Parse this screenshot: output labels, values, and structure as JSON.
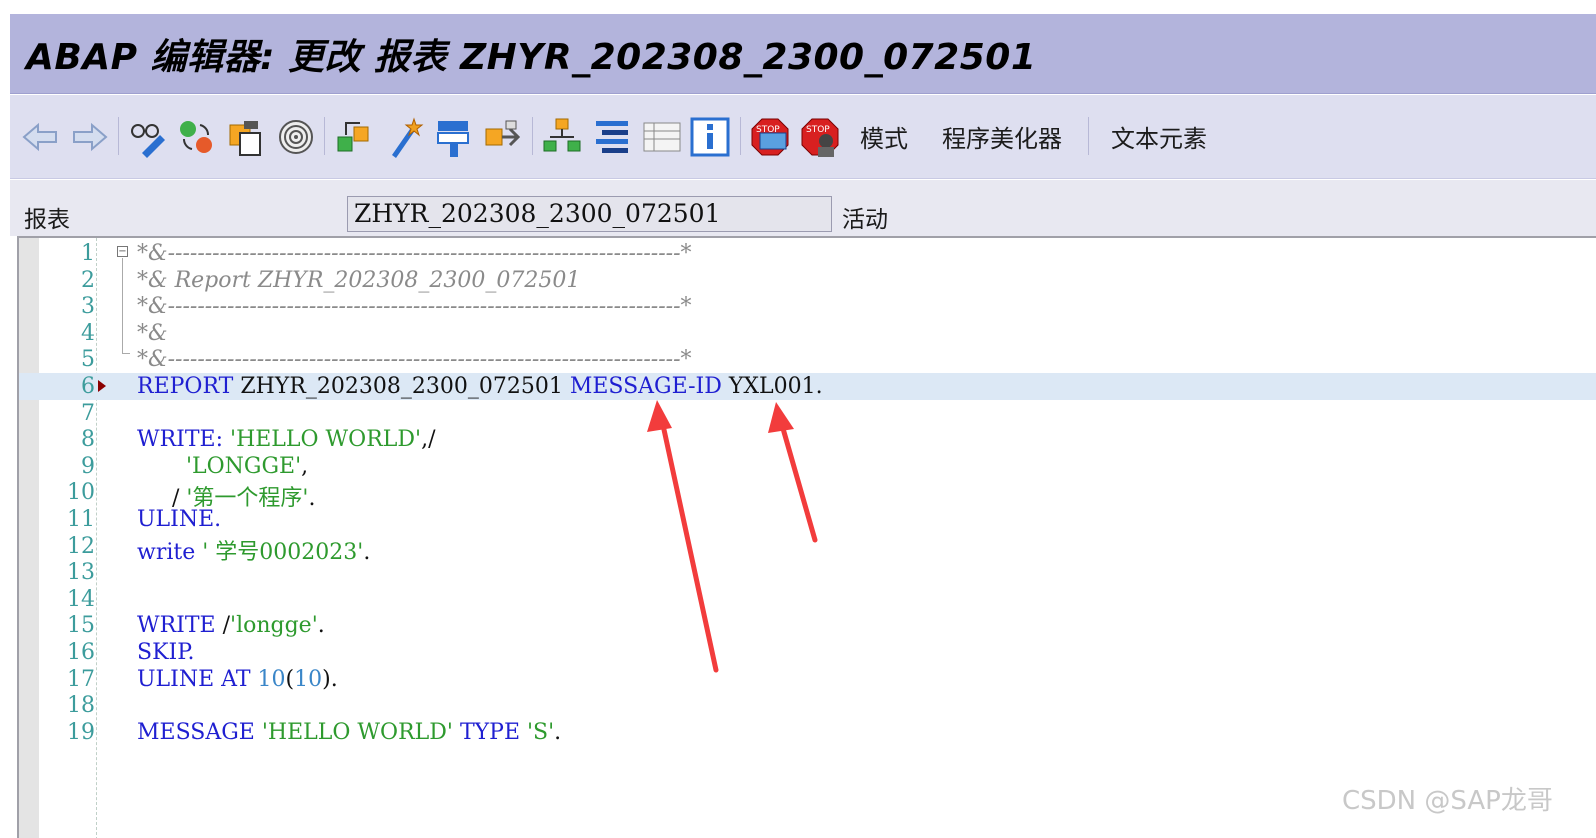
{
  "window": {
    "title": "ABAP 编辑器: 更改 报表 ZHYR_202308_2300_072501"
  },
  "toolbar": {
    "buttons": [
      {
        "name": "back-arrow-icon"
      },
      {
        "name": "forward-arrow-icon"
      },
      {
        "name": "glasses-pencil-icon"
      },
      {
        "name": "object-switch-icon"
      },
      {
        "name": "copy-object-icon"
      },
      {
        "name": "spiral-icon"
      },
      {
        "name": "check-icon"
      },
      {
        "name": "activate-wand-icon"
      },
      {
        "name": "test-run-icon"
      },
      {
        "name": "where-used-icon"
      },
      {
        "name": "hierarchy-icon"
      },
      {
        "name": "pretty-format-icon"
      },
      {
        "name": "list-view-icon"
      },
      {
        "name": "info-icon"
      },
      {
        "name": "stop-breakpoint-icon"
      },
      {
        "name": "stop-user-breakpoint-icon"
      }
    ],
    "text_buttons": [
      "模式",
      "程序美化器",
      "文本元素"
    ]
  },
  "selection": {
    "label": "报表",
    "program_name": "ZHYR_202308_2300_072501",
    "status": "活动"
  },
  "editor": {
    "lines": [
      {
        "n": "1",
        "tokens": [
          {
            "t": "*&---------------------------------------------------------------------*",
            "c": "c-cmt"
          }
        ]
      },
      {
        "n": "2",
        "tokens": [
          {
            "t": "*& Report ZHYR_202308_2300_072501",
            "c": "c-cmt"
          }
        ]
      },
      {
        "n": "3",
        "tokens": [
          {
            "t": "*&---------------------------------------------------------------------*",
            "c": "c-cmt"
          }
        ]
      },
      {
        "n": "4",
        "tokens": [
          {
            "t": "*&",
            "c": "c-cmt"
          }
        ]
      },
      {
        "n": "5",
        "tokens": [
          {
            "t": "*&---------------------------------------------------------------------*",
            "c": "c-cmt"
          }
        ]
      },
      {
        "n": "6",
        "highlight": true,
        "marker": true,
        "tokens": [
          {
            "t": "REPORT",
            "c": "c-kw"
          },
          {
            "t": " ZHYR_202308_2300_072501 ",
            "c": "c-id"
          },
          {
            "t": "MESSAGE-ID",
            "c": "c-kw"
          },
          {
            "t": " YXL001.",
            "c": "c-id"
          }
        ]
      },
      {
        "n": "7",
        "tokens": []
      },
      {
        "n": "8",
        "tokens": [
          {
            "t": "WRITE:",
            "c": "c-kw"
          },
          {
            "t": " ",
            "c": "c-id"
          },
          {
            "t": "'HELLO WORLD'",
            "c": "c-str"
          },
          {
            "t": ",/",
            "c": "c-id"
          }
        ]
      },
      {
        "n": "9",
        "tokens": [
          {
            "t": "       ",
            "c": "c-id"
          },
          {
            "t": "'LONGGE'",
            "c": "c-str"
          },
          {
            "t": ",",
            "c": "c-id"
          }
        ]
      },
      {
        "n": "10",
        "tokens": [
          {
            "t": "     / ",
            "c": "c-id"
          },
          {
            "t": "'第一个程序'",
            "c": "c-str"
          },
          {
            "t": ".",
            "c": "c-id"
          }
        ]
      },
      {
        "n": "11",
        "tokens": [
          {
            "t": "ULINE.",
            "c": "c-kw"
          }
        ]
      },
      {
        "n": "12",
        "tokens": [
          {
            "t": "write",
            "c": "c-kw"
          },
          {
            "t": " ",
            "c": "c-id"
          },
          {
            "t": "' 学号0002023'",
            "c": "c-str"
          },
          {
            "t": ".",
            "c": "c-id"
          }
        ]
      },
      {
        "n": "13",
        "tokens": []
      },
      {
        "n": "14",
        "tokens": []
      },
      {
        "n": "15",
        "tokens": [
          {
            "t": "WRITE",
            "c": "c-kw"
          },
          {
            "t": " /",
            "c": "c-id"
          },
          {
            "t": "'longge'",
            "c": "c-str"
          },
          {
            "t": ".",
            "c": "c-id"
          }
        ]
      },
      {
        "n": "16",
        "tokens": [
          {
            "t": "SKIP.",
            "c": "c-kw"
          }
        ]
      },
      {
        "n": "17",
        "tokens": [
          {
            "t": "ULINE AT",
            "c": "c-kw"
          },
          {
            "t": " ",
            "c": "c-id"
          },
          {
            "t": "10",
            "c": "c-num"
          },
          {
            "t": "(",
            "c": "c-id"
          },
          {
            "t": "10",
            "c": "c-num"
          },
          {
            "t": ").",
            "c": "c-id"
          }
        ]
      },
      {
        "n": "18",
        "tokens": []
      },
      {
        "n": "19",
        "tokens": [
          {
            "t": "MESSAGE",
            "c": "c-kw"
          },
          {
            "t": " ",
            "c": "c-id"
          },
          {
            "t": "'HELLO WORLD'",
            "c": "c-str"
          },
          {
            "t": " ",
            "c": "c-id"
          },
          {
            "t": "TYPE",
            "c": "c-kw"
          },
          {
            "t": " ",
            "c": "c-id"
          },
          {
            "t": "'S'",
            "c": "c-str"
          },
          {
            "t": ".",
            "c": "c-id"
          }
        ]
      }
    ]
  },
  "annotations": {
    "arrow_color": "#f23c3c"
  },
  "watermark": "CSDN @SAP龙哥"
}
